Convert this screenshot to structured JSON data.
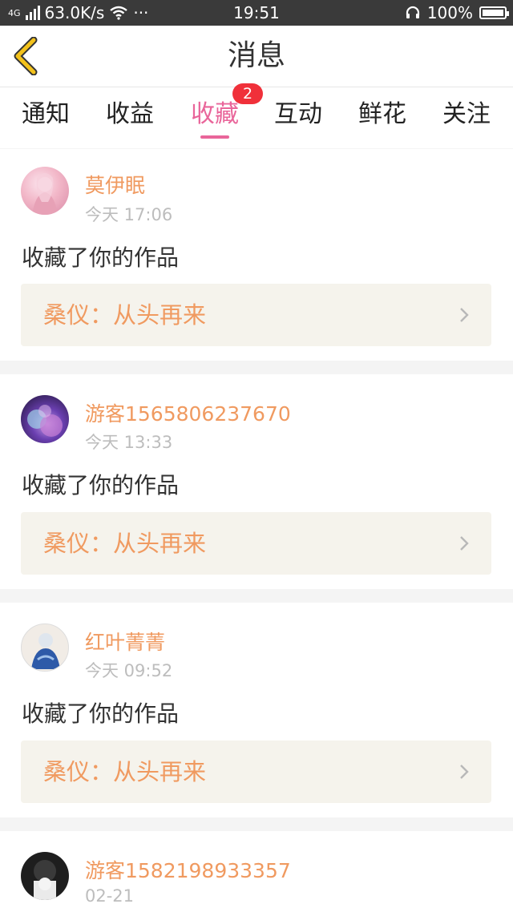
{
  "status_bar": {
    "network": "4G",
    "speed": "63.0K/s",
    "dots": "···",
    "time": "19:51",
    "battery": "100%"
  },
  "header": {
    "title": "消息",
    "back_icon": "chevron-left-icon"
  },
  "tabs": [
    {
      "label": "通知"
    },
    {
      "label": "收益"
    },
    {
      "label": "收藏",
      "active": true,
      "badge": "2"
    },
    {
      "label": "互动"
    },
    {
      "label": "鲜花"
    },
    {
      "label": "关注"
    }
  ],
  "items": [
    {
      "user": "莫伊眠",
      "time": "今天 17:06",
      "action": "收藏了你的作品",
      "work": "桑仪：从头再来"
    },
    {
      "user": "游客1565806237670",
      "time": "今天 13:33",
      "action": "收藏了你的作品",
      "work": "桑仪：从头再来"
    },
    {
      "user": "红叶菁菁",
      "time": "今天 09:52",
      "action": "收藏了你的作品",
      "work": "桑仪：从头再来"
    },
    {
      "user": "游客1582198933357",
      "time": "02-21"
    }
  ],
  "colors": {
    "accent": "#e9659a",
    "name": "#f09a60",
    "badge": "#f0303a",
    "back_arrow": "#f3c21b"
  }
}
